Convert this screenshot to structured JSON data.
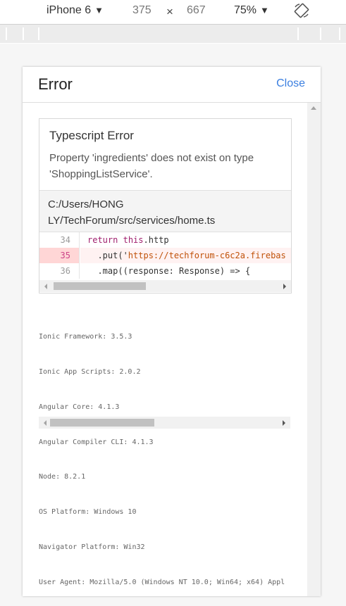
{
  "toolbar": {
    "device": "iPhone 6",
    "width": "375",
    "times": "×",
    "height": "667",
    "zoom": "75%",
    "arrow": "▼",
    "rotate_icon": "rotate-icon"
  },
  "modal": {
    "title": "Error",
    "close_label": "Close"
  },
  "error": {
    "title": "Typescript Error",
    "message": "Property 'ingredients' does not exist on type 'ShoppingListService'.",
    "file_line1": "C:/Users/HONG",
    "file_line2": "LY/TechForum/src/services/home.ts",
    "code_lines": [
      {
        "number": "34",
        "code": "return this.http"
      },
      {
        "number": "35",
        "code": "  .put('https://techforum-c6c2a.firebas"
      },
      {
        "number": "36",
        "code": "  .map((response: Response) => {"
      }
    ],
    "highlighted_line": "35"
  },
  "system_info": [
    "Ionic Framework: 3.5.3",
    "Ionic App Scripts: 2.0.2",
    "Angular Core: 4.1.3",
    "Angular Compiler CLI: 4.1.3",
    "Node: 8.2.1",
    "OS Platform: Windows 10",
    "Navigator Platform: Win32",
    "User Agent: Mozilla/5.0 (Windows NT 10.0; Win64; x64) Appl"
  ],
  "colors": {
    "close_link": "#3b7fe0",
    "highlight_line": "#ffd6d6",
    "keyword": "#a0206e",
    "string": "#c0520a"
  }
}
